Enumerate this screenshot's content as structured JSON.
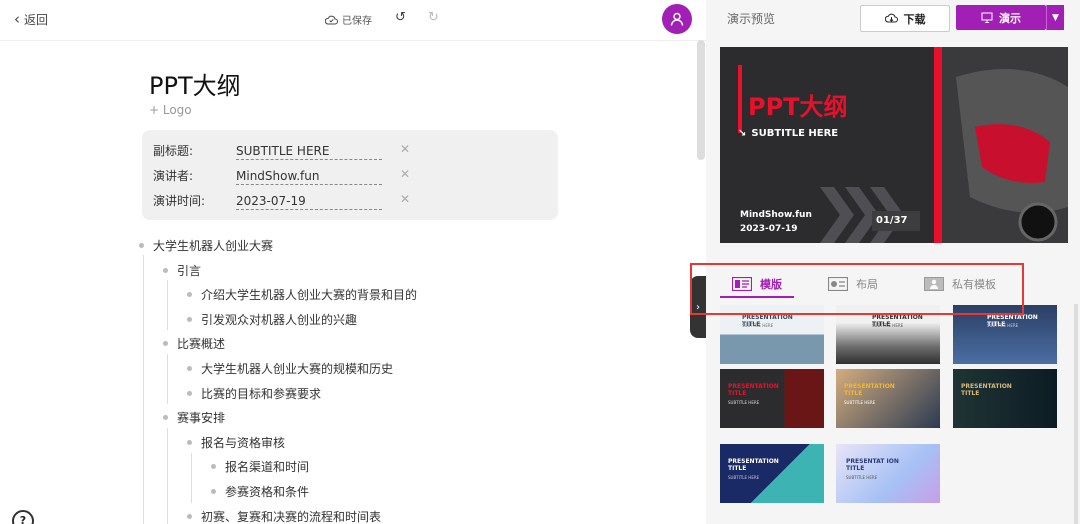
{
  "header": {
    "back_label": "返回",
    "saved_label": "已保存"
  },
  "document": {
    "title": "PPT大纲",
    "logo_label": "+ Logo",
    "meta": [
      {
        "label": "副标题:",
        "value": "SUBTITLE HERE"
      },
      {
        "label": "演讲者:",
        "value": "MindShow.fun"
      },
      {
        "label": "演讲时间:",
        "value": "2023-07-19"
      }
    ],
    "outline": [
      {
        "level": 0,
        "text": "大学生机器人创业大赛"
      },
      {
        "level": 1,
        "text": "引言"
      },
      {
        "level": 2,
        "text": "介绍大学生机器人创业大赛的背景和目的"
      },
      {
        "level": 2,
        "text": "引发观众对机器人创业的兴趣"
      },
      {
        "level": 1,
        "text": "比赛概述"
      },
      {
        "level": 2,
        "text": "大学生机器人创业大赛的规模和历史"
      },
      {
        "level": 2,
        "text": "比赛的目标和参赛要求"
      },
      {
        "level": 1,
        "text": "赛事安排"
      },
      {
        "level": 2,
        "text": "报名与资格审核"
      },
      {
        "level": 3,
        "text": "报名渠道和时间"
      },
      {
        "level": 3,
        "text": "参赛资格和条件"
      },
      {
        "level": 2,
        "text": "初赛、复赛和决赛的流程和时间表"
      }
    ]
  },
  "help_label": "?",
  "panel": {
    "preview_title": "演示预览",
    "download_label": "下载",
    "present_label": "演示",
    "slide": {
      "title": "PPT大纲",
      "subtitle": "SUBTITLE HERE",
      "author": "MindShow.fun",
      "date": "2023-07-19",
      "counter": "01/37"
    },
    "tabs": [
      {
        "label": "模版",
        "active": true,
        "icon": "template-icon"
      },
      {
        "label": "布局",
        "active": false,
        "icon": "layout-icon"
      },
      {
        "label": "私有模板",
        "active": false,
        "icon": "private-template-icon"
      }
    ],
    "templates": [
      {
        "title": "PRESENTATION TITLE",
        "sub": "SUBTITLE HERE"
      },
      {
        "title": "PRESENTATION TITLE",
        "sub": "SUBTITLE HERE"
      },
      {
        "title": "PRESENTATION TITLE",
        "sub": "SUBTITLE HERE"
      },
      {
        "title": "PRESENTATION TITLE",
        "sub": "SUBTITLE HERE"
      },
      {
        "title": "PRESENTATION TITLE",
        "sub": "SUBTITLE HERE"
      },
      {
        "title": "PRESENTATION TITLE",
        "sub": ""
      },
      {
        "title": "PRESENTATION TITLE",
        "sub": "SUBTITLE HERE"
      },
      {
        "title": "PRESENTAT ION TITLE",
        "sub": "SUBTITLE HERE"
      }
    ]
  },
  "colors": {
    "accent": "#a11fb5",
    "slide_red": "#e8102a",
    "highlight": "#e53935"
  }
}
